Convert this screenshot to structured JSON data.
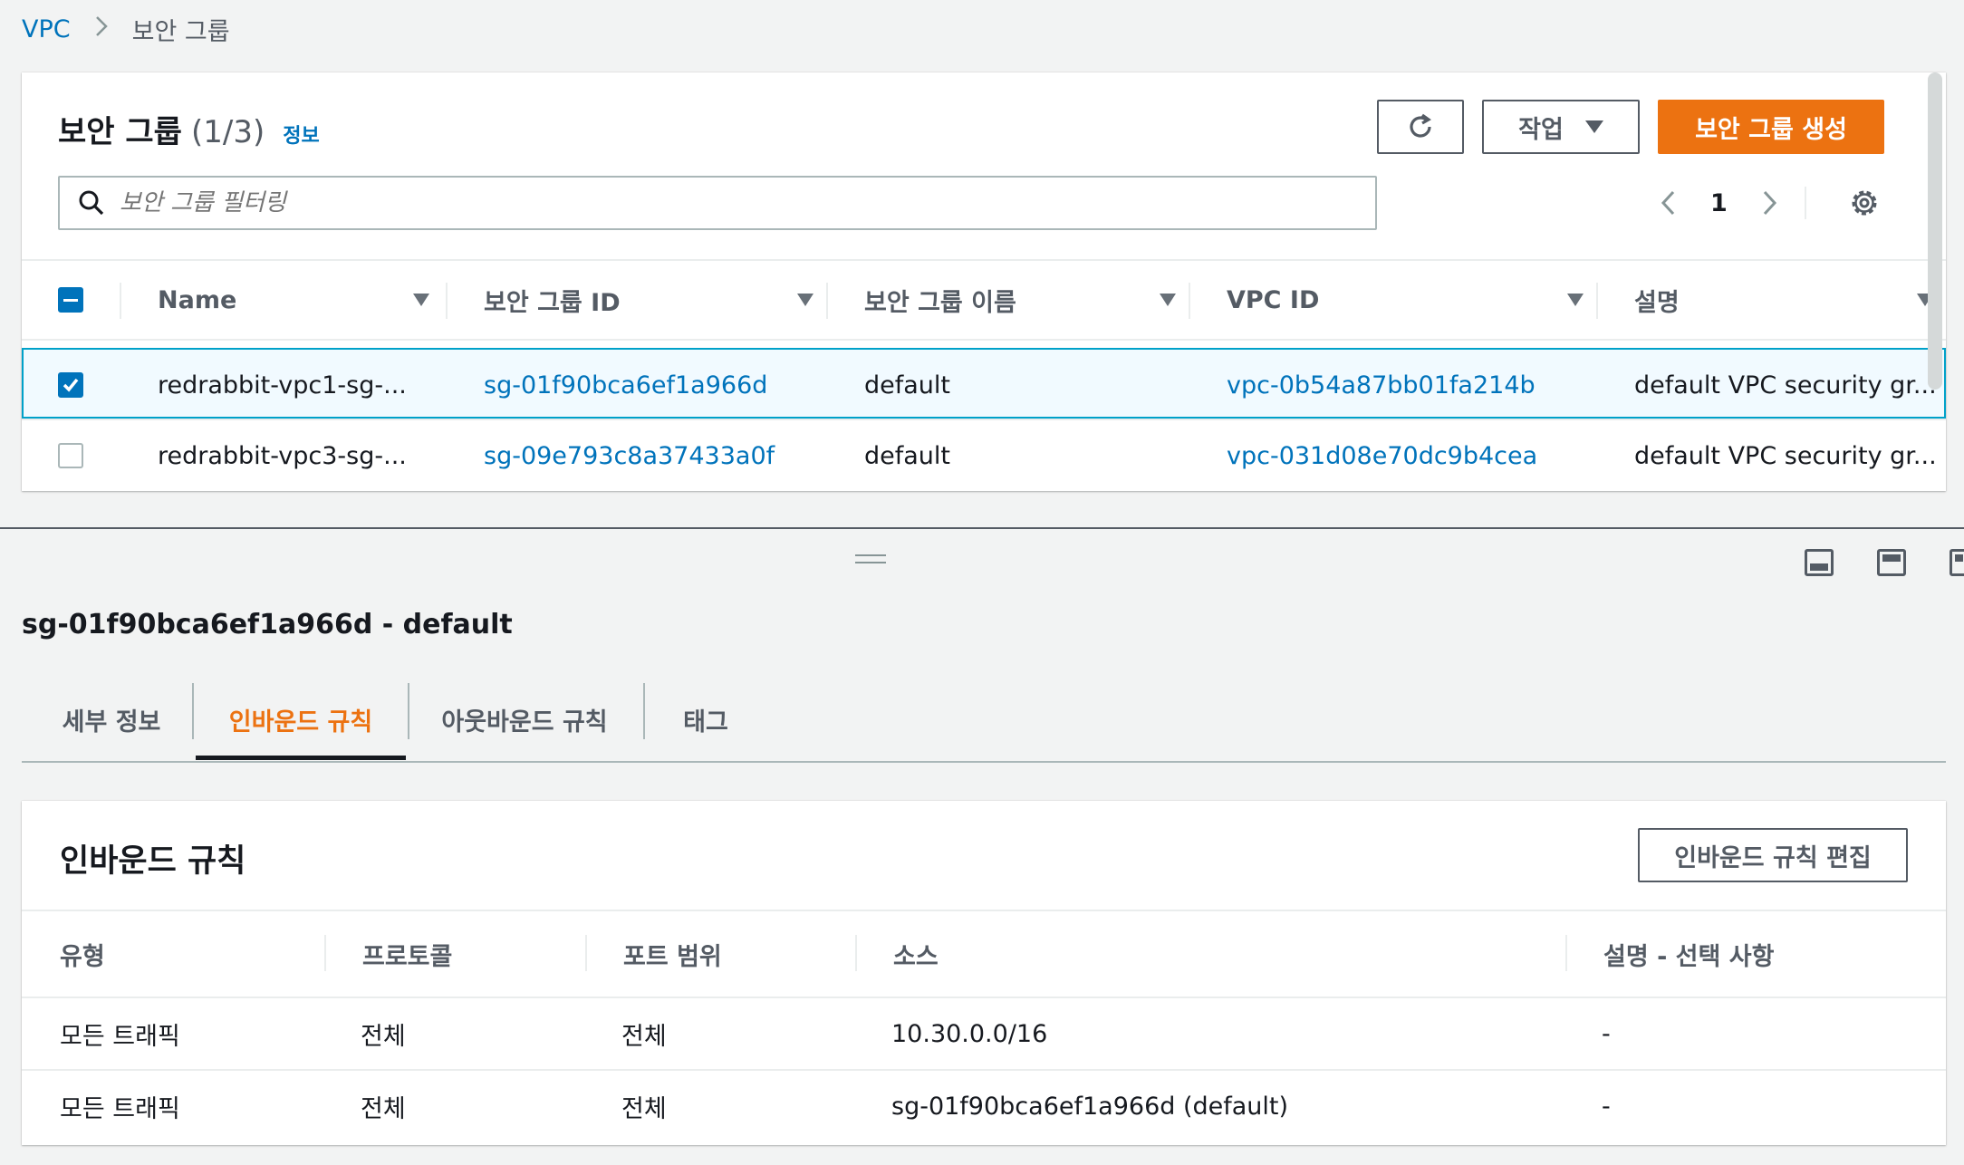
{
  "breadcrumb": {
    "root": "VPC",
    "current": "보안 그룹"
  },
  "header": {
    "title": "보안 그룹",
    "count": "(1/3)",
    "info_link": "정보",
    "actions_label": "작업",
    "create_label": "보안 그룹 생성"
  },
  "search": {
    "placeholder": "보안 그룹 필터링"
  },
  "pagination": {
    "page": "1"
  },
  "table": {
    "columns": [
      "Name",
      "보안 그룹 ID",
      "보안 그룹 이름",
      "VPC ID",
      "설명"
    ],
    "rows": [
      {
        "selected": true,
        "name": "redrabbit-vpc1-sg-...",
        "sg_id": "sg-01f90bca6ef1a966d",
        "sg_name": "default",
        "vpc_id": "vpc-0b54a87bb01fa214b",
        "desc": "default VPC security gr..."
      },
      {
        "selected": false,
        "name": "redrabbit-vpc3-sg-...",
        "sg_id": "sg-09e793c8a37433a0f",
        "sg_name": "default",
        "vpc_id": "vpc-031d08e70dc9b4cea",
        "desc": "default VPC security gr..."
      }
    ]
  },
  "detail": {
    "title": "sg-01f90bca6ef1a966d - default",
    "tabs": [
      "세부 정보",
      "인바운드 규칙",
      "아웃바운드 규칙",
      "태그"
    ],
    "active_tab": "인바운드 규칙"
  },
  "inbound": {
    "title": "인바운드 규칙",
    "edit_label": "인바운드 규칙 편집",
    "columns": [
      "유형",
      "프로토콜",
      "포트 범위",
      "소스",
      "설명 - 선택 사항"
    ],
    "rows": [
      {
        "type": "모든 트래픽",
        "protocol": "전체",
        "port": "전체",
        "source": "10.30.0.0/16",
        "desc": "-"
      },
      {
        "type": "모든 트래픽",
        "protocol": "전체",
        "port": "전체",
        "source": "sg-01f90bca6ef1a966d (default)",
        "desc": "-"
      }
    ]
  },
  "colors": {
    "accent": "#ec7211",
    "link": "#0073bb",
    "selected_border": "#00a1c9"
  },
  "icons": [
    "search-icon",
    "refresh-icon",
    "caret-down-icon",
    "chevron-left-icon",
    "chevron-right-icon",
    "gear-icon",
    "sort-icon",
    "checkbox-icon",
    "drag-handle-icon",
    "panel-icon"
  ]
}
